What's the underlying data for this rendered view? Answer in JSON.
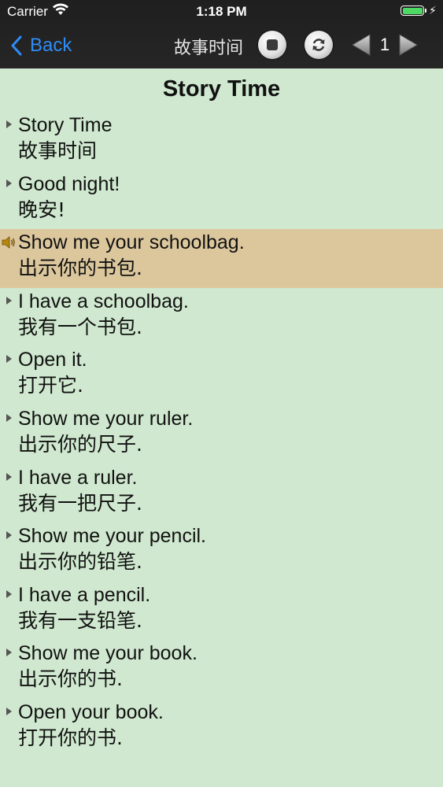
{
  "status": {
    "carrier": "Carrier",
    "time": "1:18 PM"
  },
  "nav": {
    "back_label": "Back",
    "title": "故事时间",
    "page_number": "1",
    "icons": [
      "stop-icon",
      "refresh-icon",
      "prev-arrow-icon",
      "next-arrow-icon"
    ]
  },
  "content": {
    "heading": "Story Time",
    "lines": [
      {
        "en": "Story Time",
        "zh": "故事时间",
        "active": false
      },
      {
        "en": "Good night!",
        "zh": "晚安!",
        "active": false
      },
      {
        "en": "Show me your schoolbag.",
        "zh": "出示你的书包.",
        "active": true
      },
      {
        "en": "I have a schoolbag.",
        "zh": "我有一个书包.",
        "active": false
      },
      {
        "en": "Open it.",
        "zh": "打开它.",
        "active": false
      },
      {
        "en": "Show me your ruler.",
        "zh": "出示你的尺子.",
        "active": false
      },
      {
        "en": "I have a ruler.",
        "zh": "我有一把尺子.",
        "active": false
      },
      {
        "en": "Show me your pencil.",
        "zh": "出示你的铅笔.",
        "active": false
      },
      {
        "en": "I have a pencil.",
        "zh": "我有一支铅笔.",
        "active": false
      },
      {
        "en": "Show me your book.",
        "zh": "出示你的书.",
        "active": false
      },
      {
        "en": "Open your book.",
        "zh": "打开你的书.",
        "active": false
      }
    ]
  },
  "colors": {
    "background": "#cfe8cf",
    "active_row": "#dcc79d",
    "nav_bar": "#242424",
    "back_accent": "#2f8cf6",
    "battery": "#4cd964"
  }
}
